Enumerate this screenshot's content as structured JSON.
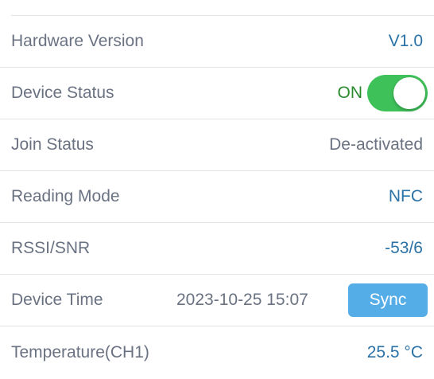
{
  "rows": {
    "hardware_version": {
      "label": "Hardware Version",
      "value": "V1.0"
    },
    "device_status": {
      "label": "Device Status",
      "value": "ON",
      "toggle_on": true,
      "toggle_color": "#3fc15a"
    },
    "join_status": {
      "label": "Join Status",
      "value": "De-activated"
    },
    "reading_mode": {
      "label": "Reading Mode",
      "value": "NFC"
    },
    "rssi_snr": {
      "label": "RSSI/SNR",
      "value": "-53/6"
    },
    "device_time": {
      "label": "Device Time",
      "value": "2023-10-25 15:07",
      "button_label": "Sync",
      "button_color": "#55ade8"
    },
    "temperature": {
      "label": "Temperature(CH1)",
      "value": "25.5 °C"
    }
  },
  "colors": {
    "label_text": "#6a7282",
    "value_accent": "#2b72a7",
    "status_on_text": "#2a8a2e",
    "divider": "#e3e3e6"
  }
}
